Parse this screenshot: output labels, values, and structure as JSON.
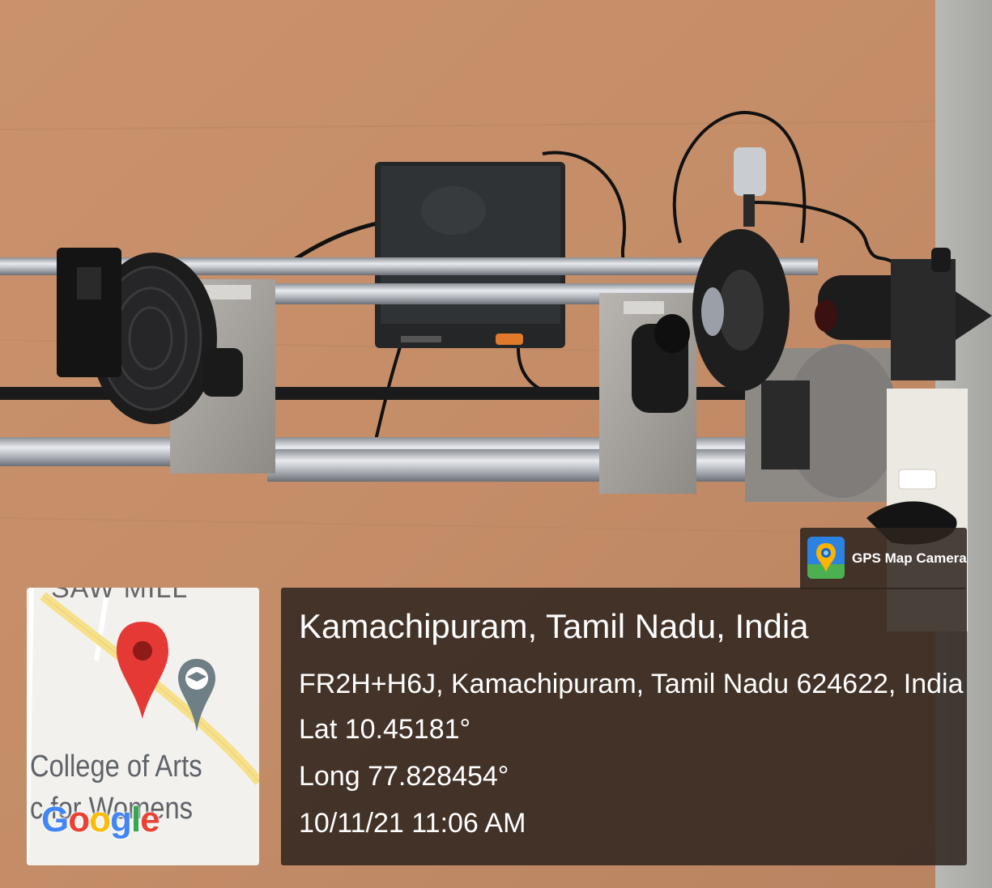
{
  "photo": {
    "subject": "optical bench with mounted lens, eyepiece and laser on a wooden table"
  },
  "map": {
    "top_label": "SAW MILL",
    "place_label_line1": "College of Arts",
    "place_label_line2": "c for Womens",
    "logo": "Google",
    "pin_color": "#e53935",
    "road_color": "#f6e08a"
  },
  "gps_badge": {
    "label": "GPS Map Camera",
    "icon": "map-camera-icon"
  },
  "location": {
    "title": "Kamachipuram, Tamil Nadu, India",
    "address": "FR2H+H6J, Kamachipuram, Tamil Nadu 624622, India",
    "lat": "Lat 10.45181°",
    "long": "Long 77.828454°",
    "datetime": "10/11/21 11:06 AM"
  }
}
